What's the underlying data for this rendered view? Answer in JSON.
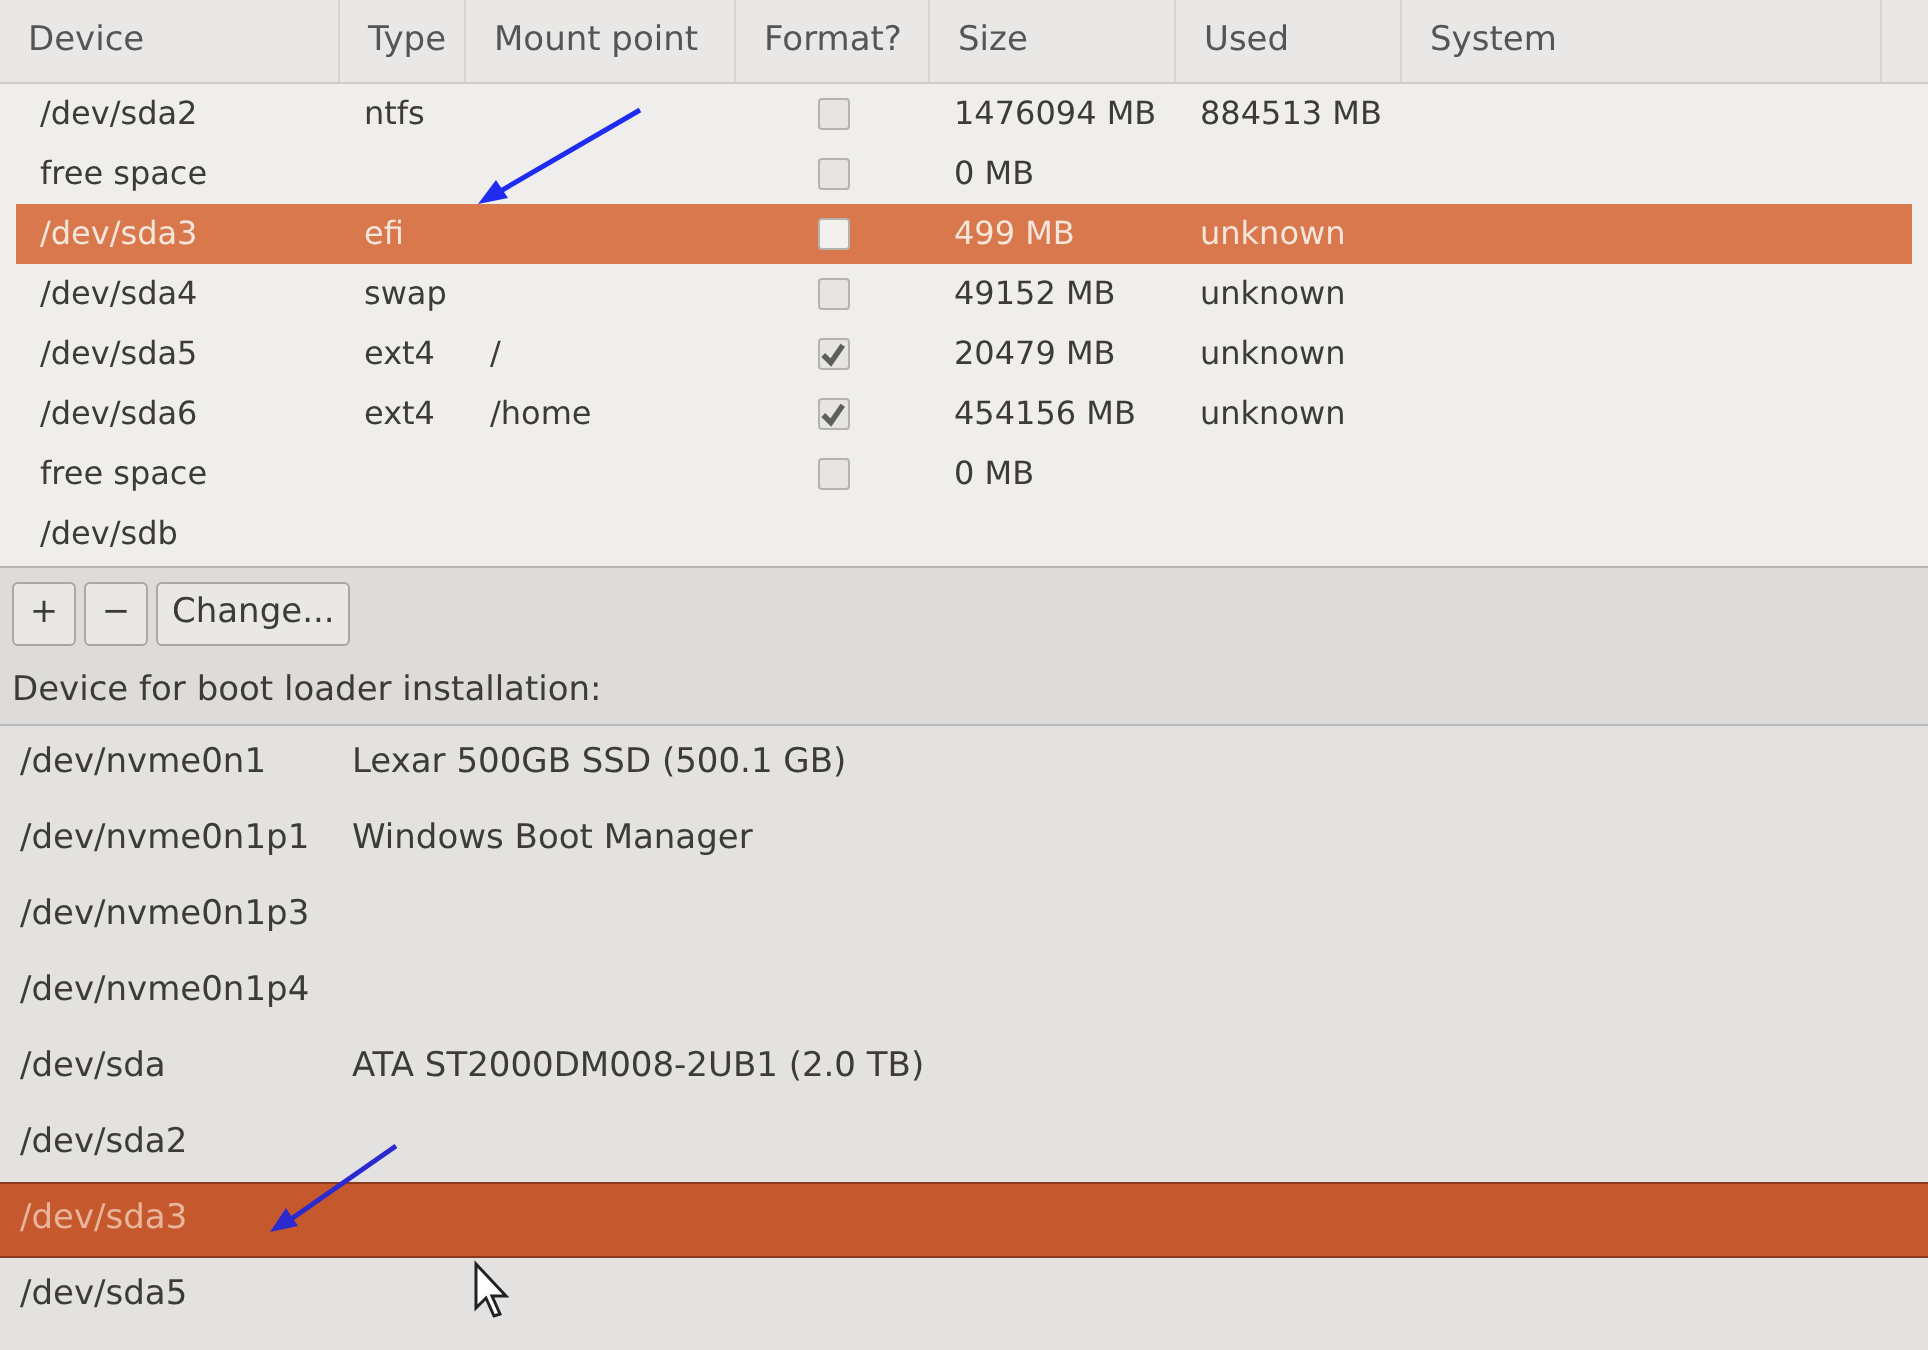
{
  "partition_table": {
    "columns": [
      "Device",
      "Type",
      "Mount point",
      "Format?",
      "Size",
      "Used",
      "System"
    ],
    "rows": [
      {
        "device": "/dev/sda2",
        "type": "ntfs",
        "format": false,
        "size": "1476094 MB",
        "used": "884513 MB",
        "selected": false
      },
      {
        "device": "free space",
        "format": false,
        "size": "0 MB",
        "selected": false
      },
      {
        "device": "/dev/sda3",
        "type": "efi",
        "format": false,
        "size": "499 MB",
        "used": "unknown",
        "selected": true
      },
      {
        "device": "/dev/sda4",
        "type": "swap",
        "format": false,
        "size": "49152 MB",
        "used": "unknown",
        "selected": false
      },
      {
        "device": "/dev/sda5",
        "type": "ext4",
        "mount": "/",
        "format": true,
        "size": "20479 MB",
        "used": "unknown",
        "selected": false
      },
      {
        "device": "/dev/sda6",
        "type": "ext4",
        "mount": "/home",
        "format": true,
        "size": "454156 MB",
        "used": "unknown",
        "selected": false
      },
      {
        "device": "free space",
        "format": false,
        "size": "0 MB",
        "selected": false
      },
      {
        "device": "/dev/sdb",
        "selected": false
      }
    ]
  },
  "buttons": [
    "+",
    "−",
    "Change..."
  ],
  "boot_loader": {
    "label": "Device for boot loader installation:",
    "items": [
      {
        "device": "/dev/nvme0n1",
        "description": "Lexar 500GB SSD (500.1 GB)",
        "selected": false
      },
      {
        "device": "/dev/nvme0n1p1",
        "description": "Windows Boot Manager",
        "selected": false
      },
      {
        "device": "/dev/nvme0n1p3",
        "selected": false
      },
      {
        "device": "/dev/nvme0n1p4",
        "selected": false
      },
      {
        "device": "/dev/sda",
        "description": "ATA ST2000DM008-2UB1 (2.0 TB)",
        "selected": false
      },
      {
        "device": "/dev/sda2",
        "selected": false
      },
      {
        "device": "/dev/sda3",
        "selected": true
      },
      {
        "device": "/dev/sda5",
        "selected": false
      }
    ]
  }
}
